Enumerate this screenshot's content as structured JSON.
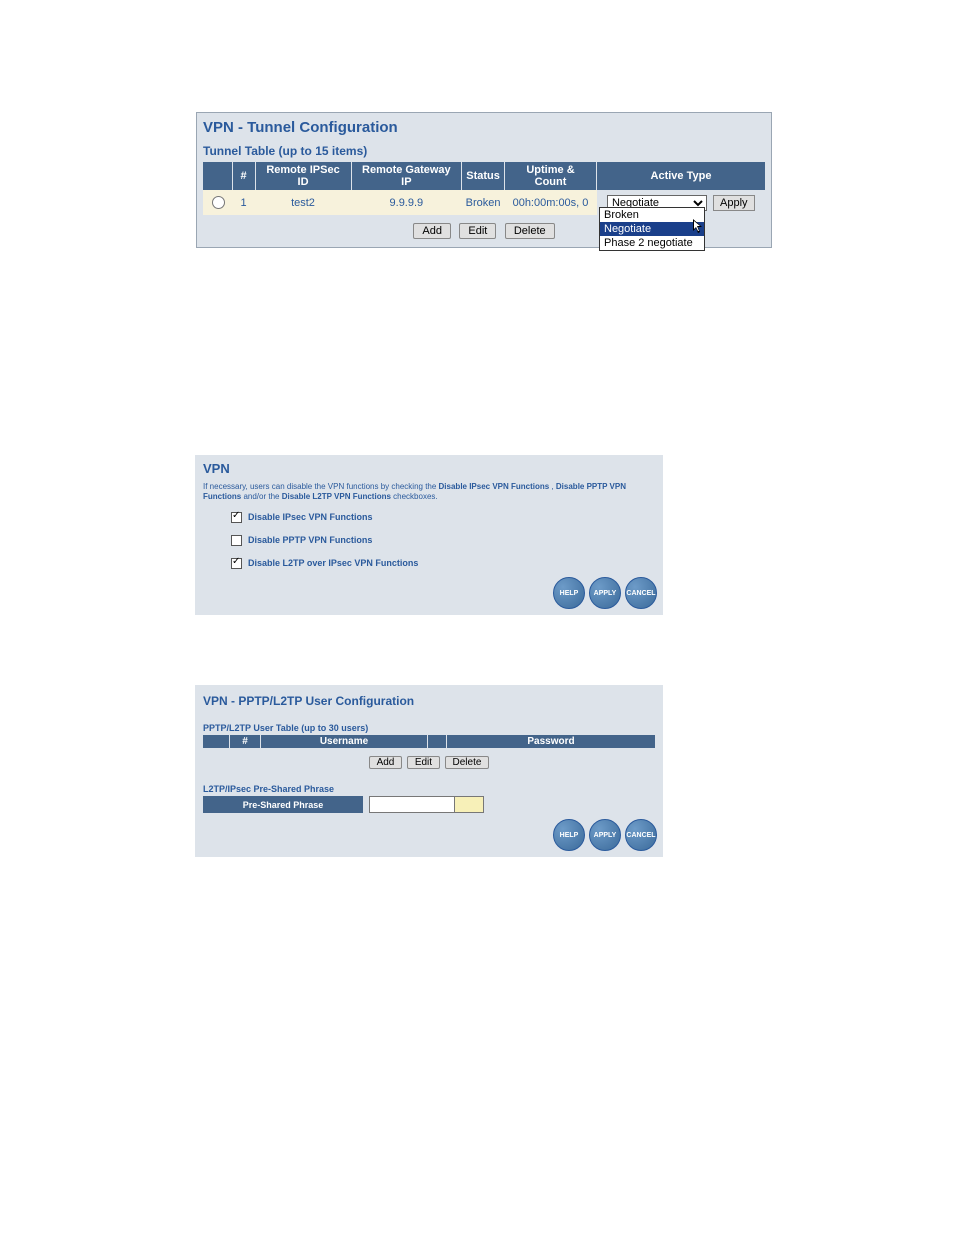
{
  "tunnel": {
    "title": "VPN - Tunnel Configuration",
    "subtitle": "Tunnel Table (up to 15 items)",
    "columns": {
      "hash": "#",
      "remote_ipsec_id": "Remote IPSec ID",
      "remote_gateway_ip": "Remote Gateway IP",
      "status": "Status",
      "uptime_count": "Uptime & Count",
      "active_type": "Active Type"
    },
    "row": {
      "num": "1",
      "remote_ipsec_id": "test2",
      "remote_gateway_ip": "9.9.9.9",
      "status": "Broken",
      "uptime_count": "00h:00m:00s,  0",
      "active_type_selected": "Negotiate",
      "apply_label": "Apply"
    },
    "buttons": {
      "add": "Add",
      "edit": "Edit",
      "delete": "Delete"
    },
    "dropdown": {
      "opt1": "Broken",
      "opt2": "Negotiate",
      "opt3": "Phase 2 negotiate"
    }
  },
  "vpn": {
    "title": "VPN",
    "desc_pre": "If necessary, users can disable the VPN functions by checking the ",
    "desc_b1": "Disable IPsec VPN Functions",
    "desc_mid1": " , ",
    "desc_b2": "Disable PPTP VPN Functions",
    "desc_mid2": " and/or the ",
    "desc_b3": "Disable L2TP VPN Functions",
    "desc_post": " checkboxes.",
    "chk1": "Disable IPsec VPN Functions",
    "chk2": "Disable PPTP VPN Functions",
    "chk3": "Disable L2TP over IPsec VPN Functions",
    "help": "HELP",
    "apply": "APPLY",
    "cancel": "CANCEL"
  },
  "users": {
    "title": "VPN - PPTP/L2TP User Configuration",
    "subtitle": "PPTP/L2TP User Table (up to 30 users)",
    "columns": {
      "hash": "#",
      "username": "Username",
      "password": "Password"
    },
    "buttons": {
      "add": "Add",
      "edit": "Edit",
      "delete": "Delete"
    },
    "psp_section": "L2TP/IPsec Pre-Shared Phrase",
    "psp_label": "Pre-Shared Phrase",
    "help": "HELP",
    "apply": "APPLY",
    "cancel": "CANCEL"
  }
}
